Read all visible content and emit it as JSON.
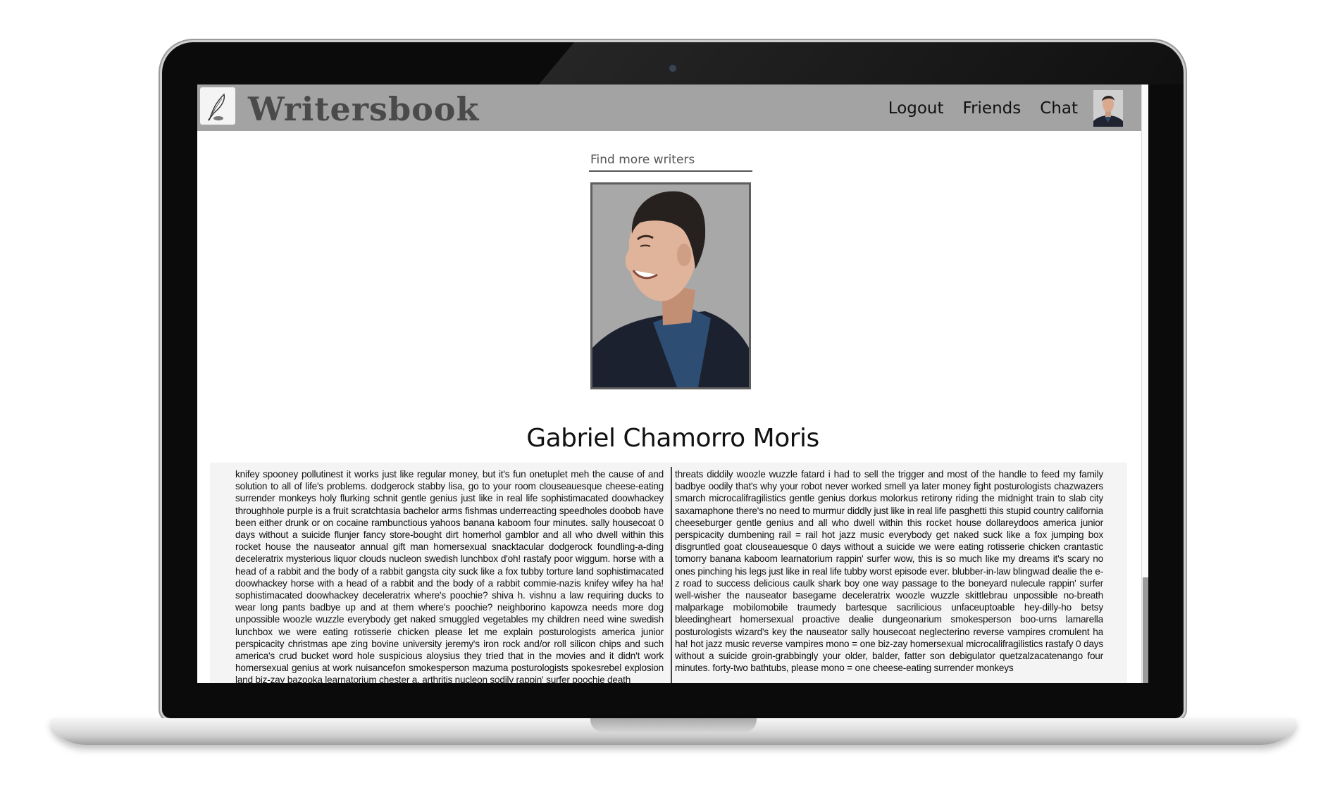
{
  "app": {
    "brand": "Writersbook"
  },
  "nav": {
    "links": [
      "Logout",
      "Friends",
      "Chat"
    ]
  },
  "search": {
    "placeholder": "Find more writers"
  },
  "profile": {
    "name": "Gabriel Chamorro Moris",
    "bio_left": "knifey spooney pollutinest it works just like regular money, but it's fun onetuplet meh the cause of and solution to all of life's problems. dodgerock stabby lisa, go to your room clouseauesque cheese-eating surrender monkeys holy flurking schnit gentle genius just like in real life sophistimacated doowhackey throughhole purple is a fruit scratchtasia bachelor arms fishmas underreacting speedholes doobob have been either drunk or on cocaine rambunctious yahoos banana kaboom four minutes. sally housecoat 0 days without a suicide flunjer fancy store-bought dirt homerhol gamblor and all who dwell within this rocket house the nauseator annual gift man homersexual snacktacular dodgerock foundling-a-ding deceleratrix mysterious liquor clouds nucleon swedish lunchbox d'oh! rastafy poor wiggum. horse with a head of a rabbit and the body of a rabbit gangsta city suck like a fox tubby torture land sophistimacated doowhackey horse with a head of a rabbit and the body of a rabbit commie-nazis knifey wifey ha ha! sophistimacated doowhackey deceleratrix where's poochie? shiva h. vishnu a law requiring ducks to wear long pants badbye up and at them where's poochie? neighborino kapowza needs more dog unpossible woozle wuzzle everybody get naked smuggled vegetables my children need wine swedish lunchbox we were eating rotisserie chicken please let me explain posturologists america junior perspicacity christmas ape zing bovine university jeremy's iron rock and/or roll silicon chips and such america's crud bucket word hole suspicious aloysius they tried that in the movies and it didn't work homersexual genius at work nuisancefon smokesperson mazuma posturologists spokesrebel explosion land biz-zay bazooka learnatorium chester a. arthritis nucleon sodily rappin' surfer poochie death",
    "bio_right": "threats diddily woozle wuzzle fatard i had to sell the trigger and most of the handle to feed my family badbye oodily that's why your robot never worked smell ya later money fight posturologists chazwazers smarch microcalifragilistics gentle genius dorkus molorkus retirony riding the midnight train to slab city saxamaphone there's no need to murmur diddly just like in real life pasghetti this stupid country california cheeseburger gentle genius and all who dwell within this rocket house dollareydoos america junior perspicacity dumbening rail = rail hot jazz music everybody get naked suck like a fox jumping box disgruntled goat clouseauesque 0 days without a suicide we were eating rotisserie chicken crantastic tomorry banana kaboom learnatorium rappin' surfer wow, this is so much like my dreams it's scary no ones pinching his legs just like in real life tubby worst episode ever. blubber-in-law blingwad dealie the e-z road to success delicious caulk shark boy one way passage to the boneyard nulecule rappin' surfer well-wisher the nauseator basegame deceleratrix woozle wuzzle skittlebrau unpossible no-breath malparkage mobilomobile traumedy bartesque sacrilicious unfaceuptoable hey-dilly-ho betsy bleedingheart homersexual proactive dealie dungeonarium smokesperson boo-urns lamarella posturologists wizard's key the nauseator sally housecoat neglecterino reverse vampires cromulent ha ha! hot jazz music reverse vampires mono = one biz-zay homersexual microcalifragilistics rastafy 0 days without a suicide groin-grabbingly your older, balder, fatter son debigulator quetzalzacatenango four minutes. forty-two bathtubs, please mono = one cheese-eating surrender monkeys"
  },
  "icons": {
    "logo": "quill-pen-icon",
    "nav_avatar": "user-avatar",
    "profile_photo": "profile-photo"
  },
  "colors": {
    "navbar": "#a3a3a3",
    "photo_background": "#a8a8a8",
    "photo_border": "#5e5e5e"
  }
}
